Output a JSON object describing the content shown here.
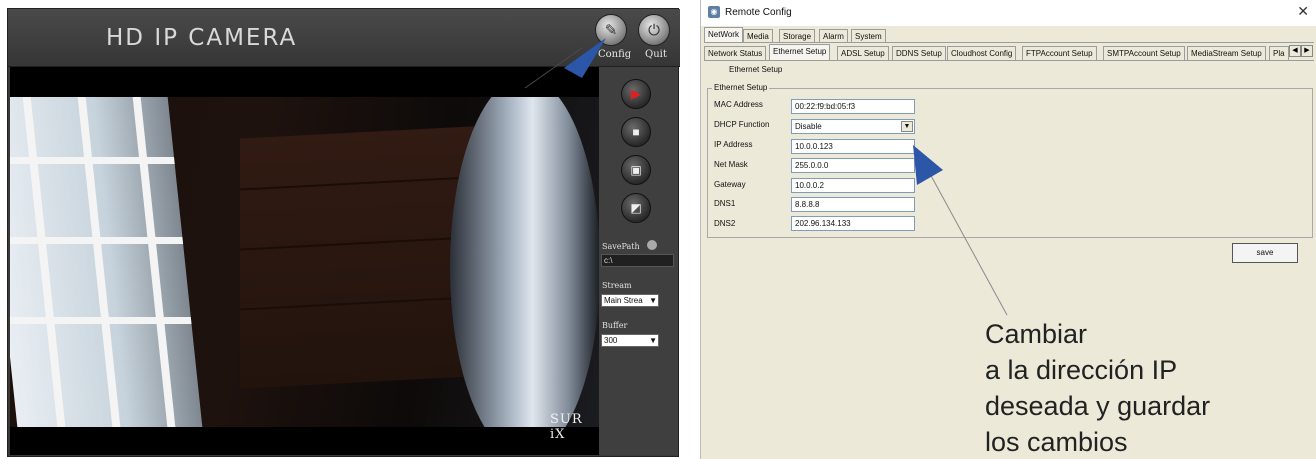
{
  "camera_app": {
    "title": "HD IP CAMERA",
    "config_label": "Config",
    "quit_label": "Quit",
    "brand_overlay": "SUR iX",
    "controls": [
      "record-icon",
      "stop-icon",
      "snapshot-icon",
      "clip-icon"
    ],
    "save_path_label": "SavePath",
    "save_path_value": "c:\\",
    "stream_label": "Stream",
    "stream_value": "Main Strea",
    "buffer_label": "Buffer",
    "buffer_value": "300",
    "colors": {
      "panel": "#3a3a3a",
      "record": "#e02020",
      "accent_arrow": "#2c56a8"
    }
  },
  "remote_config": {
    "title": "Remote Config",
    "close_glyph": "✕",
    "tabs_row1": [
      "NetWork",
      "Media",
      "Storage",
      "Alarm",
      "System"
    ],
    "tabs_row2": [
      "Network Status",
      "Ethernet Setup",
      "ADSL Setup",
      "DDNS Setup",
      "Cloudhost Config",
      "FTPAccount Setup",
      "SMTPAccount Setup",
      "MediaStream Setup",
      "Pla"
    ],
    "active_tab_row1": "NetWork",
    "active_tab_row2": "Ethernet Setup",
    "sub_tab": "Ethernet Setup",
    "group_title": "Ethernet Setup",
    "fields": [
      {
        "label": "MAC Address",
        "value": "00:22:f9:bd:05:f3"
      },
      {
        "label": "DHCP Function",
        "value": "Disable",
        "dropdown": true
      },
      {
        "label": "IP Address",
        "value": "10.0.0.123"
      },
      {
        "label": "Net Mask",
        "value": "255.0.0.0"
      },
      {
        "label": "Gateway",
        "value": "10.0.0.2"
      },
      {
        "label": "DNS1",
        "value": "8.8.8.8"
      },
      {
        "label": "DNS2",
        "value": "202.96.134.133"
      }
    ],
    "save_label": "save"
  },
  "annotation": {
    "text": "Cambiar\na la dirección IP\ndeseada y guardar\nlos cambios"
  }
}
